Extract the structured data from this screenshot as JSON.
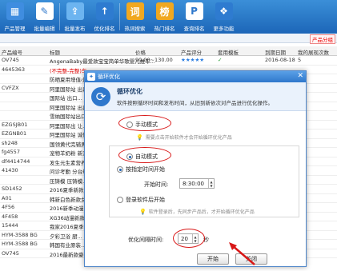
{
  "toolbar": {
    "items": [
      {
        "label": "产品管理",
        "icon": "product-icon",
        "glyph": "▦"
      },
      {
        "label": "批量编辑",
        "icon": "edit-icon",
        "glyph": "✎"
      },
      {
        "label": "批量发布",
        "icon": "publish-icon",
        "glyph": "⇪"
      },
      {
        "label": "优化排名",
        "icon": "rank-icon",
        "glyph": "↑"
      },
      {
        "label": "热词搜索",
        "icon": "hotword-icon",
        "glyph": "词"
      },
      {
        "label": "热门排名",
        "icon": "hotrank-icon",
        "glyph": "榜"
      },
      {
        "label": "查询排名",
        "icon": "query-icon",
        "glyph": "P"
      },
      {
        "label": "更多功能",
        "icon": "more-icon",
        "glyph": "❖"
      }
    ]
  },
  "subbar": {
    "warning": "产品分组"
  },
  "table": {
    "headers": {
      "code": "产品编号",
      "title": "标题",
      "price": "价格",
      "score": "产品评分",
      "template": "套用模板",
      "date": "到期日期",
      "count": "我的展现次数"
    },
    "rows": [
      {
        "code": "OV745",
        "title": "AngenaBaby最爱款宝宝简单华歌婴儿推车...",
        "price": "90.00~130.00",
        "stars": "★★★★★",
        "check": "✓",
        "date": "2016-08-18",
        "n": "5"
      },
      {
        "code": "4645363",
        "title": "(不完整-完整)车...",
        "price": "",
        "stars": "",
        "check": "",
        "date": "",
        "n": "",
        "red": true
      },
      {
        "code": "",
        "title": "防晒夏用增值小...",
        "price": "",
        "stars": "",
        "check": "",
        "date": "",
        "n": ""
      },
      {
        "code": "CVFZX",
        "title": "阿里国际站 出口...",
        "price": "",
        "stars": "",
        "check": "",
        "date": "",
        "n": ""
      },
      {
        "code": "",
        "title": "国际站 出口...",
        "price": "",
        "stars": "",
        "check": "",
        "date": "",
        "n": ""
      },
      {
        "code": "",
        "title": "阿里国际站 出口...",
        "price": "",
        "stars": "",
        "check": "",
        "date": "",
        "n": ""
      },
      {
        "code": "",
        "title": "雪纳国际站出口...",
        "price": "",
        "stars": "",
        "check": "",
        "date": "",
        "n": ""
      },
      {
        "code": "EZGSJB01",
        "title": "阿里国际出 让...",
        "price": "",
        "stars": "",
        "check": "",
        "date": "",
        "n": ""
      },
      {
        "code": "EZGNB01",
        "title": "阿里国际站 诚信...",
        "price": "",
        "stars": "",
        "check": "",
        "date": "",
        "n": ""
      },
      {
        "code": "sh248",
        "title": "国领黄代完辅男式...",
        "price": "",
        "stars": "",
        "check": "",
        "date": "",
        "n": ""
      },
      {
        "code": "fg4557",
        "title": "宠物羊奶粉 新宠...",
        "price": "",
        "stars": "",
        "check": "",
        "date": "",
        "n": ""
      },
      {
        "code": "df4414744",
        "title": "发生元生素营养...",
        "price": "",
        "stars": "",
        "check": "",
        "date": "",
        "n": ""
      },
      {
        "code": "41430",
        "title": "问诊考勤 分台线...",
        "price": "",
        "stars": "",
        "check": "",
        "date": "",
        "n": ""
      },
      {
        "code": "",
        "title": "压铸模 压铸模...",
        "price": "",
        "stars": "",
        "check": "",
        "date": "",
        "n": ""
      },
      {
        "code": "SD1452",
        "title": "2016夏季新款大...",
        "price": "",
        "stars": "",
        "check": "",
        "date": "",
        "n": ""
      },
      {
        "code": "A01",
        "title": "韩新白色新款女...",
        "price": "",
        "stars": "",
        "check": "",
        "date": "",
        "n": ""
      },
      {
        "code": "4F56",
        "title": "2016新季动漫...",
        "price": "",
        "stars": "",
        "check": "",
        "date": "",
        "n": ""
      },
      {
        "code": "4F458",
        "title": "XG36动漫新款原...",
        "price": "",
        "stars": "",
        "check": "",
        "date": "",
        "n": "2"
      },
      {
        "code": "15444",
        "title": "我家2016夏季女...",
        "price": "",
        "stars": "",
        "check": "",
        "date": "",
        "n": "2"
      },
      {
        "code": "HYM-3588 BG",
        "title": "夕彩卫浴 厨...",
        "price": "",
        "stars": "",
        "check": "",
        "date": "",
        "n": ""
      },
      {
        "code": "HYM-3588 BG",
        "title": "韩国有业原装...",
        "price": "",
        "stars": "",
        "check": "",
        "date": "",
        "n": ""
      },
      {
        "code": "OV745",
        "title": "2016最新款豪婴...",
        "price": "",
        "stars": "",
        "check": "",
        "date": "",
        "n": ""
      }
    ]
  },
  "dialog": {
    "window_title": "循环优化",
    "heading": "循环优化",
    "description": "软件按照循环时间和发布时间，从旧到新依次对产品进行优化操作。",
    "manual_mode": "手动模式",
    "manual_hint": "需要点击开始软件才会开始循环优化产品",
    "auto_mode": "自动模式",
    "timed_start": "按指定时间开始",
    "start_time_label": "开始时间:",
    "start_time_value": "8:30:00",
    "login_start": "登录软件后开始",
    "login_hint": "软件登录后，先同步产品后，才开始循环优化产品",
    "interval_label": "优化间隔时间:",
    "interval_value": "20",
    "interval_unit": "秒",
    "start_button": "开始",
    "close_button": "关闭"
  },
  "colors": {
    "accent": "#1c66b8",
    "highlight": "#d81818"
  }
}
